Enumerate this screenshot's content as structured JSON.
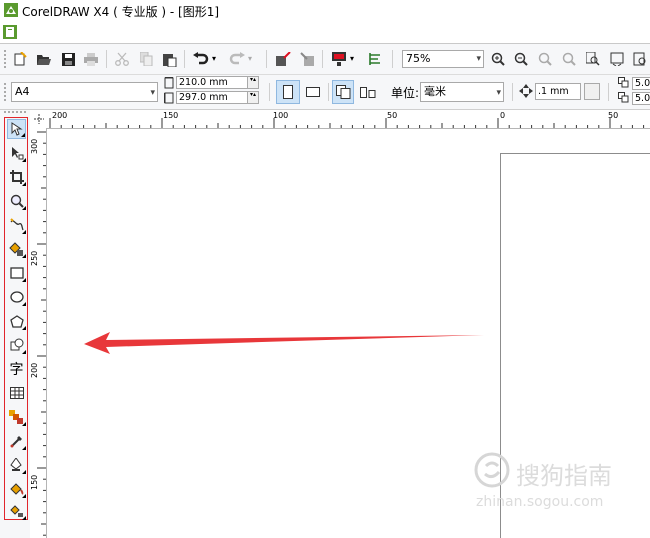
{
  "window": {
    "title": "CorelDRAW X4 ( 专业版 ) - [图形1]"
  },
  "toolbar": {
    "zoom_value": "75%"
  },
  "propertybar": {
    "page_size": "A4",
    "width_value": "210.0 mm",
    "height_value": "297.0 mm",
    "units_label": "单位:",
    "units_value": "毫米",
    "nudge_value": ".1 mm",
    "dup_x": "5.0",
    "dup_y": "5.0"
  },
  "rulers": {
    "h_labels": [
      "200",
      "150",
      "100",
      "50",
      "0",
      "50"
    ],
    "v_labels": [
      "300",
      "250",
      "200",
      "150"
    ]
  },
  "toolbox": {
    "text_tool_glyph": "字"
  },
  "watermark": {
    "line1": "搜狗指南",
    "line2": "zhinan.sogou.com"
  },
  "colors": {
    "accent_red": "#e1252c",
    "arrow_red": "#e8373a"
  }
}
